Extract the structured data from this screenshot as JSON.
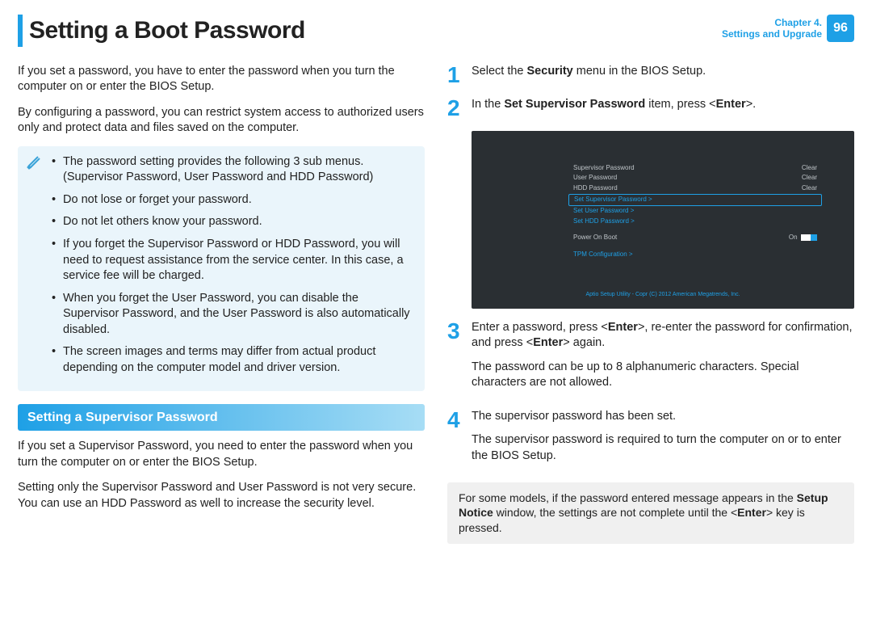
{
  "header": {
    "title": "Setting a Boot Password",
    "chapter_line1": "Chapter 4.",
    "chapter_line2": "Settings and Upgrade",
    "page_number": "96"
  },
  "left": {
    "intro_p1": "If you set a password, you have to enter the password when you turn the computer on or enter the BIOS Setup.",
    "intro_p2": "By configuring a password, you can restrict system access to authorized users only and protect data and files saved on the computer.",
    "notes": [
      "The password setting provides the following 3 sub menus. (Supervisor Password, User Password and HDD Password)",
      "Do not lose or forget your password.",
      "Do not let others know your password.",
      "If you forget the Supervisor Password or HDD Password, you will need to request assistance from the service center. In this case, a service fee will be charged.",
      "When you forget the User Password, you can disable the Supervisor Password, and the User Password is also automatically disabled.",
      "The screen images and terms may differ from actual product depending on the computer model and driver version."
    ],
    "section_header": "Setting a Supervisor Password",
    "sup_p1": "If you set a Supervisor Password, you need to enter the password when you turn the computer on or enter the BIOS Setup.",
    "sup_p2": "Setting only the Supervisor Password and User Password is not very secure. You can use an HDD Password as well to increase the security level."
  },
  "right": {
    "step1": {
      "num": "1",
      "pre": "Select the ",
      "bold": "Security",
      "post": " menu in the BIOS Setup."
    },
    "step2": {
      "num": "2",
      "pre": "In the ",
      "bold": "Set Supervisor Password",
      "mid": " item, press <",
      "bold2": "Enter",
      "post": ">."
    },
    "bios": {
      "r1_label": "Supervisor Password",
      "r1_val": "Clear",
      "r2_label": "User Password",
      "r2_val": "Clear",
      "r3_label": "HDD Password",
      "r3_val": "Clear",
      "r4_label": "Set Supervisor Password >",
      "r5_label": "Set User Password >",
      "r6_label": "Set HDD Password >",
      "r7_label": "Power On Boot",
      "r7_val": "On",
      "r8_label": "TPM Configuration >",
      "footer": "Aptio Setup Utility - Copr (C) 2012 American Megatrends, Inc."
    },
    "step3": {
      "num": "3",
      "p1_a": "Enter a password, press <",
      "p1_b": "Enter",
      "p1_c": ">, re-enter the password for confirmation, and press <",
      "p1_d": "Enter",
      "p1_e": "> again.",
      "p2": "The password can be up to 8 alphanumeric characters. Special characters are not allowed."
    },
    "step4": {
      "num": "4",
      "p1": "The supervisor password has been set.",
      "p2": "The supervisor password is required to turn the computer on or to enter the BIOS Setup."
    },
    "grey_note": {
      "a": "For some models, if the password entered message appears in the ",
      "b": "Setup Notice",
      "c": " window, the settings are not complete until the <",
      "d": "Enter",
      "e": "> key is pressed."
    }
  }
}
